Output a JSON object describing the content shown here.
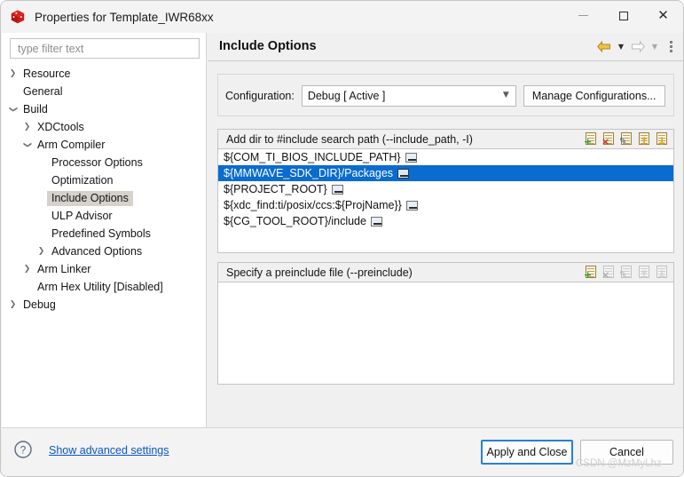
{
  "window": {
    "title": "Properties for Template_IWR68xx",
    "app_icon": "red-cube-icon",
    "controls": {
      "minimize": "minimize-icon",
      "maximize": "maximize-icon",
      "close": "close-icon"
    }
  },
  "sidebar": {
    "filter": {
      "placeholder": "type filter text",
      "value": ""
    },
    "items": [
      {
        "label": "Resource",
        "indent": 0,
        "chevron": "right",
        "selected": false
      },
      {
        "label": "General",
        "indent": 0,
        "chevron": "none",
        "selected": false
      },
      {
        "label": "Build",
        "indent": 0,
        "chevron": "down",
        "selected": false
      },
      {
        "label": "XDCtools",
        "indent": 1,
        "chevron": "right",
        "selected": false
      },
      {
        "label": "Arm Compiler",
        "indent": 1,
        "chevron": "down",
        "selected": false
      },
      {
        "label": "Processor Options",
        "indent": 2,
        "chevron": "none",
        "selected": false
      },
      {
        "label": "Optimization",
        "indent": 2,
        "chevron": "none",
        "selected": false
      },
      {
        "label": "Include Options",
        "indent": 2,
        "chevron": "none",
        "selected": true
      },
      {
        "label": "ULP Advisor",
        "indent": 2,
        "chevron": "none",
        "selected": false
      },
      {
        "label": "Predefined Symbols",
        "indent": 2,
        "chevron": "none",
        "selected": false
      },
      {
        "label": "Advanced Options",
        "indent": 2,
        "chevron": "right",
        "selected": false
      },
      {
        "label": "Arm Linker",
        "indent": 1,
        "chevron": "right",
        "selected": false
      },
      {
        "label": "Arm Hex Utility  [Disabled]",
        "indent": 1,
        "chevron": "none",
        "selected": false
      },
      {
        "label": "Debug",
        "indent": 0,
        "chevron": "right",
        "selected": false
      }
    ]
  },
  "main": {
    "page_title": "Include Options",
    "nav": {
      "back_icon": "back-arrow-icon",
      "back_caret_icon": "chevron-down-icon",
      "forward_icon": "forward-arrow-icon",
      "forward_caret_icon": "chevron-down-icon",
      "menu_icon": "vertical-dots-menu-icon"
    },
    "configuration": {
      "label": "Configuration:",
      "selected": "Debug  [ Active ]",
      "options": [
        "Debug  [ Active ]"
      ],
      "caret_icon": "chevron-down-icon",
      "manage_button": "Manage Configurations..."
    },
    "include_group": {
      "title": "Add dir to #include search path (--include_path, -I)",
      "tools": [
        {
          "name": "add-include-path-button",
          "icon": "add-document-icon",
          "glyph": "+",
          "enabled": true
        },
        {
          "name": "delete-include-path-button",
          "icon": "delete-document-icon",
          "glyph": "×",
          "enabled": true
        },
        {
          "name": "edit-include-path-button",
          "icon": "edit-document-icon",
          "glyph": "✎",
          "enabled": true
        },
        {
          "name": "move-up-include-path-button",
          "icon": "move-up-icon",
          "glyph": "↑",
          "enabled": true
        },
        {
          "name": "move-down-include-path-button",
          "icon": "move-down-icon",
          "glyph": "↓",
          "enabled": true
        }
      ],
      "rows": [
        {
          "text": "${COM_TI_BIOS_INCLUDE_PATH}",
          "badge": "variable-badge-icon",
          "selected": false
        },
        {
          "text": "${MMWAVE_SDK_DIR}/Packages",
          "badge": "variable-badge-icon",
          "selected": true
        },
        {
          "text": "${PROJECT_ROOT}",
          "badge": "variable-badge-icon",
          "selected": false
        },
        {
          "text": "${xdc_find:ti/posix/ccs:${ProjName}}",
          "badge": "variable-badge-icon",
          "selected": false
        },
        {
          "text": "${CG_TOOL_ROOT}/include",
          "badge": "variable-badge-icon",
          "selected": false
        }
      ]
    },
    "preinclude_group": {
      "title": "Specify a preinclude file (--preinclude)",
      "tools": [
        {
          "name": "add-preinclude-file-button",
          "icon": "add-document-icon",
          "glyph": "+",
          "enabled": true
        },
        {
          "name": "delete-preinclude-file-button",
          "icon": "delete-document-icon",
          "glyph": "×",
          "enabled": false
        },
        {
          "name": "edit-preinclude-file-button",
          "icon": "edit-document-icon",
          "glyph": "✎",
          "enabled": false
        },
        {
          "name": "move-up-preinclude-file-button",
          "icon": "move-up-icon",
          "glyph": "↑",
          "enabled": false
        },
        {
          "name": "move-down-preinclude-file-button",
          "icon": "move-down-icon",
          "glyph": "↓",
          "enabled": false
        }
      ],
      "rows": []
    }
  },
  "footer": {
    "help_icon": "help-question-icon",
    "advanced_link": "Show advanced settings",
    "apply_button": "Apply and Close",
    "cancel_button": "Cancel",
    "watermark": "CSDN @MzMyLhz"
  },
  "colors": {
    "selection_blue": "#0a6ccf",
    "tree_selection_gray": "#d5d2cc",
    "link_blue": "#0a57c2",
    "default_button_border": "#2a7fd4",
    "panel_gray": "#f0f0f0",
    "back_arrow_gold": "#e0a200"
  }
}
